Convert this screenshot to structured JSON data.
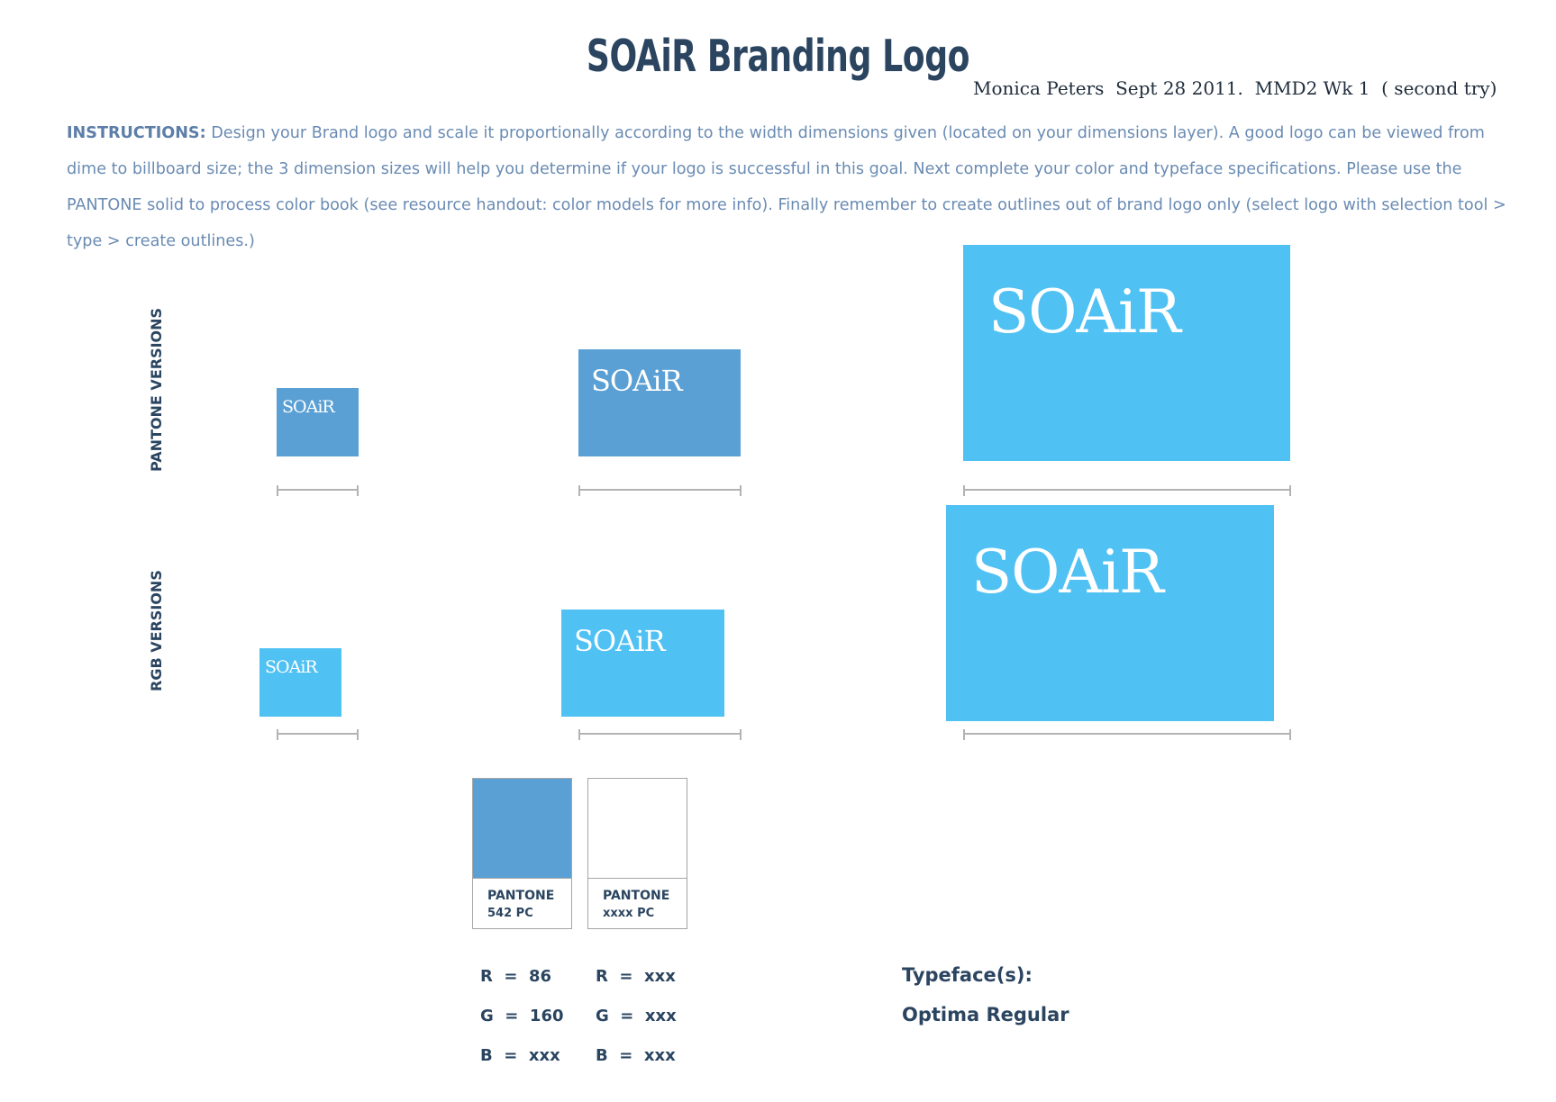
{
  "header": {
    "title": "SOAiR Branding Logo",
    "author": "Monica Peters  Sept 28 2011.  MMD2 Wk 1  ( second try)"
  },
  "instructions": {
    "lead": "INSTRUCTIONS:",
    "body": " Design your Brand logo and scale it proportionally according to the width dimensions given (located on your dimensions layer). A good logo can be viewed from dime to billboard size; the 3 dimension sizes will help you determine if your logo is successful in this goal. Next complete your color and typeface specifications. Please use the PANTONE solid to process color book (see resource handout: color models for more info). Finally remember to create outlines out of brand logo only (select logo with selection tool > type > create outlines.)"
  },
  "rows": {
    "pantone_label": "PANTONE VERSIONS",
    "rgb_label": "RGB VERSIONS"
  },
  "logo": {
    "text": "SOAiR"
  },
  "colors": {
    "pantone_blue": "#5aa0d4",
    "rgb_blue": "#50c1f3",
    "text_navy": "#2b4560",
    "instructions_blue": "#6a8bb3",
    "dimension_gray": "#b3b3b3"
  },
  "swatches": [
    {
      "line1": "PANTONE",
      "line2": "542 PC",
      "color": "#5aa0d4"
    },
    {
      "line1": "PANTONE",
      "line2": "xxxx PC",
      "color": "#ffffff"
    }
  ],
  "rgb_values": {
    "col1": [
      "R  =  86",
      "G  =  160",
      "B  =  xxx"
    ],
    "col2": [
      "R  =  xxx",
      "G  =  xxx",
      "B  =  xxx"
    ]
  },
  "typeface": {
    "heading": "Typeface(s):",
    "name": "Optima Regular"
  }
}
